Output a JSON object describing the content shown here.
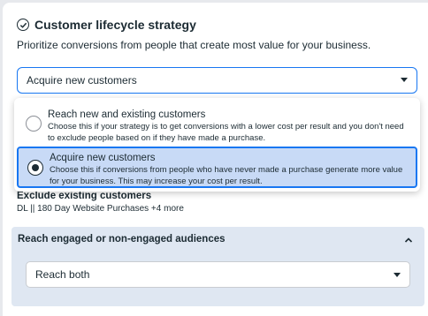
{
  "header": {
    "title": "Customer lifecycle strategy",
    "subtitle": "Prioritize conversions from people that create most value for your business."
  },
  "strategy_select": {
    "value": "Acquire new customers"
  },
  "dropdown": {
    "options": [
      {
        "title": "Reach new and existing customers",
        "description": "Choose this if your strategy is to get conversions with a lower cost per result and you don't need to exclude people based on if they have made a purchase.",
        "selected": false
      },
      {
        "title": "Acquire new customers",
        "description": "Choose this if conversions from people who have never made a purchase generate more value for your business. This may increase your cost per result.",
        "selected": true
      }
    ]
  },
  "exclude": {
    "title": "Exclude existing customers",
    "value": "DL || 180 Day Website Purchases +4 more"
  },
  "engaged_section": {
    "title": "Reach engaged or non-engaged audiences",
    "select_value": "Reach both"
  },
  "colors": {
    "accent": "#1877f2",
    "selected_bg": "#c8daf6",
    "section_bg": "#dfe7f2"
  }
}
